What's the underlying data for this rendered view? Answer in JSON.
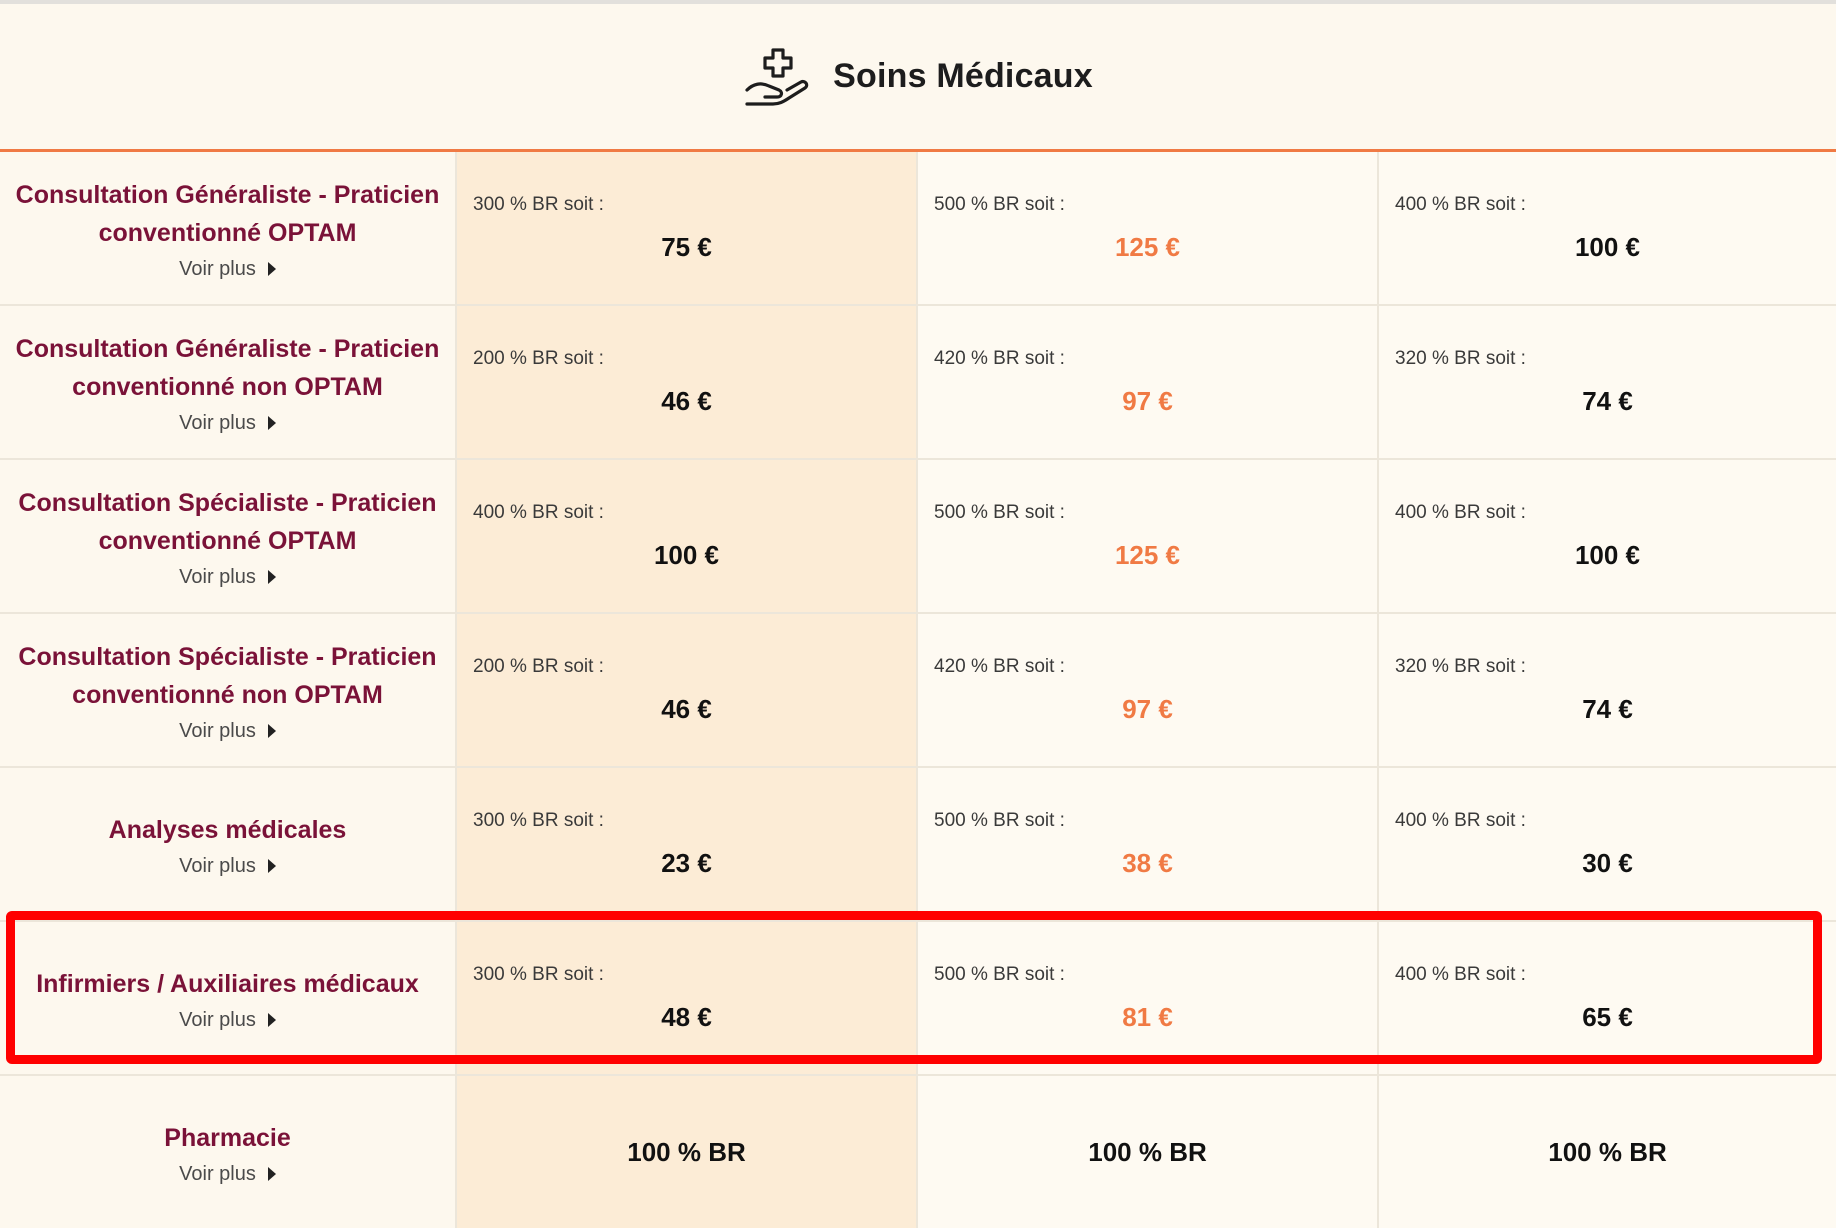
{
  "header": {
    "title": "Soins Médicaux",
    "icon": "hand-medical-cross-icon"
  },
  "colors": {
    "label": "#7a1238",
    "accent": "#f07a44",
    "highlight": "#ff0000"
  },
  "rows": [
    {
      "label": "Consultation Généraliste - Praticien conventionné OPTAM",
      "voir": "Voir plus",
      "cols": [
        {
          "pct": "300 % BR soit :",
          "amount": "75 €"
        },
        {
          "pct": "500 % BR soit :",
          "amount": "125 €"
        },
        {
          "pct": "400 % BR soit :",
          "amount": "100 €"
        }
      ]
    },
    {
      "label": "Consultation Généraliste - Praticien conventionné non OPTAM",
      "voir": "Voir plus",
      "cols": [
        {
          "pct": "200 % BR soit :",
          "amount": "46 €"
        },
        {
          "pct": "420 % BR soit :",
          "amount": "97 €"
        },
        {
          "pct": "320 % BR soit :",
          "amount": "74 €"
        }
      ]
    },
    {
      "label": "Consultation Spécialiste - Praticien conventionné OPTAM",
      "voir": "Voir plus",
      "cols": [
        {
          "pct": "400 % BR soit :",
          "amount": "100 €"
        },
        {
          "pct": "500 % BR soit :",
          "amount": "125 €"
        },
        {
          "pct": "400 % BR soit :",
          "amount": "100 €"
        }
      ]
    },
    {
      "label": "Consultation Spécialiste - Praticien conventionné non OPTAM",
      "voir": "Voir plus",
      "cols": [
        {
          "pct": "200 % BR soit :",
          "amount": "46 €"
        },
        {
          "pct": "420 % BR soit :",
          "amount": "97 €"
        },
        {
          "pct": "320 % BR soit :",
          "amount": "74 €"
        }
      ]
    },
    {
      "label": "Analyses médicales",
      "voir": "Voir plus",
      "cols": [
        {
          "pct": "300 % BR soit :",
          "amount": "23 €"
        },
        {
          "pct": "500 % BR soit :",
          "amount": "38 €"
        },
        {
          "pct": "400 % BR soit :",
          "amount": "30 €"
        }
      ]
    },
    {
      "label": "Infirmiers / Auxiliaires médicaux",
      "voir": "Voir plus",
      "cols": [
        {
          "pct": "300 % BR soit :",
          "amount": "48 €"
        },
        {
          "pct": "500 % BR soit :",
          "amount": "81 €"
        },
        {
          "pct": "400 % BR soit :",
          "amount": "65 €"
        }
      ]
    },
    {
      "label": "Pharmacie",
      "voir": "Voir plus",
      "cols": [
        {
          "full": "100 % BR"
        },
        {
          "full": "100 % BR"
        },
        {
          "full": "100 % BR"
        }
      ]
    }
  ]
}
